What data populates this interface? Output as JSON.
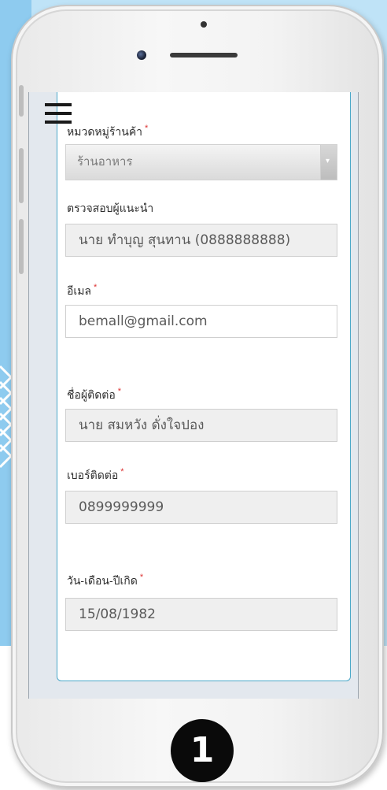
{
  "form": {
    "category": {
      "label": "หมวดหมู่ร้านค้า",
      "required_mark": "*",
      "value": "ร้านอาหาร"
    },
    "referrer": {
      "label": "ตรวจสอบผู้แนะนำ",
      "value": "นาย ทำบุญ สุนทาน (0888888888)"
    },
    "email": {
      "label": "อีเมล",
      "required_mark": "*",
      "value": "bemall@gmail.com"
    },
    "contact_name": {
      "label": "ชื่อผู้ติดต่อ",
      "required_mark": "*",
      "value": "นาย สมหวัง ดั่งใจปอง"
    },
    "phone": {
      "label": "เบอร์ติดต่อ",
      "required_mark": "*",
      "value": "0899999999"
    },
    "birthdate": {
      "label": "วัน-เดือน-ปีเกิด",
      "required_mark": "*",
      "value": "15/08/1982"
    }
  },
  "home_button": {
    "label": "1"
  },
  "icons": {
    "menu": "hamburger-menu-icon",
    "dropdown": "chevron-down-icon"
  },
  "colors": {
    "required": "#dd3333",
    "card_border": "#4aa8c9",
    "background": "#bfe3f7"
  }
}
